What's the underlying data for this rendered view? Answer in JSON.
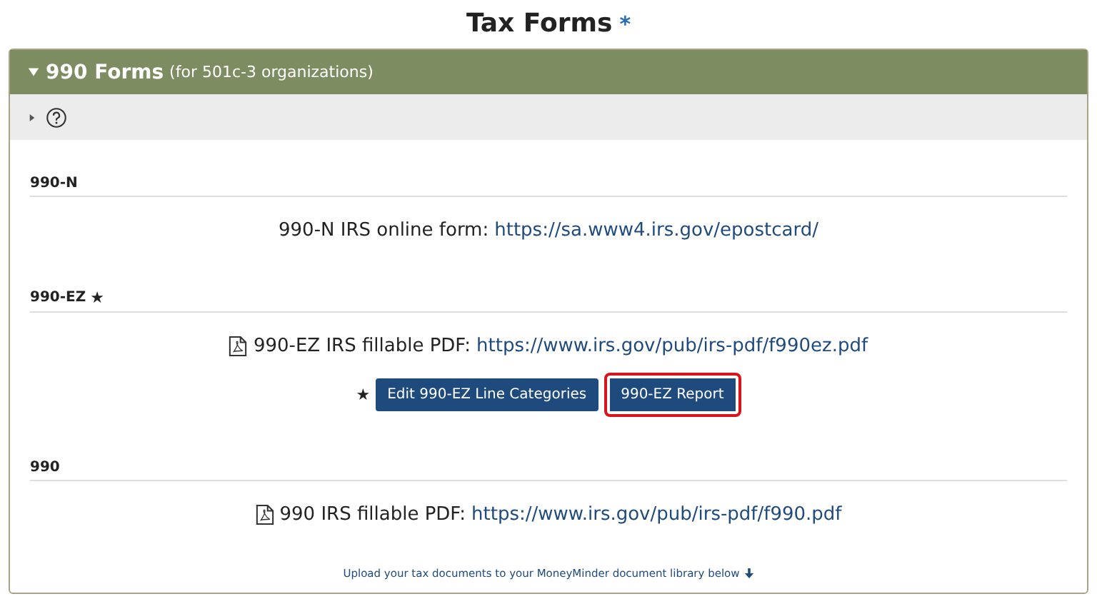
{
  "title": {
    "text": "Tax Forms",
    "required_mark": "*"
  },
  "panel": {
    "heading": "990 Forms",
    "subheading": "(for 501c-3 organizations)",
    "expanded": true,
    "help_bar": {
      "expanded": false
    },
    "sections": [
      {
        "kind": "online",
        "label": "990-N",
        "link_label": "990-N IRS online form:",
        "url": "https://sa.www4.irs.gov/epostcard/"
      },
      {
        "kind": "pdf",
        "label": "990-EZ",
        "label_mark": "★",
        "link_label": "990-EZ IRS fillable PDF:",
        "url": "https://www.irs.gov/pub/irs-pdf/f990ez.pdf",
        "buttons_mark": "★",
        "buttons": [
          {
            "label": "Edit 990-EZ Line Categories",
            "highlighted": false
          },
          {
            "label": "990-EZ Report",
            "highlighted": true
          }
        ]
      },
      {
        "kind": "pdf",
        "label": "990",
        "link_label": "990 IRS fillable PDF:",
        "url": "https://www.irs.gov/pub/irs-pdf/f990.pdf"
      }
    ],
    "footer": "Upload your tax documents to your MoneyMinder document library below"
  }
}
